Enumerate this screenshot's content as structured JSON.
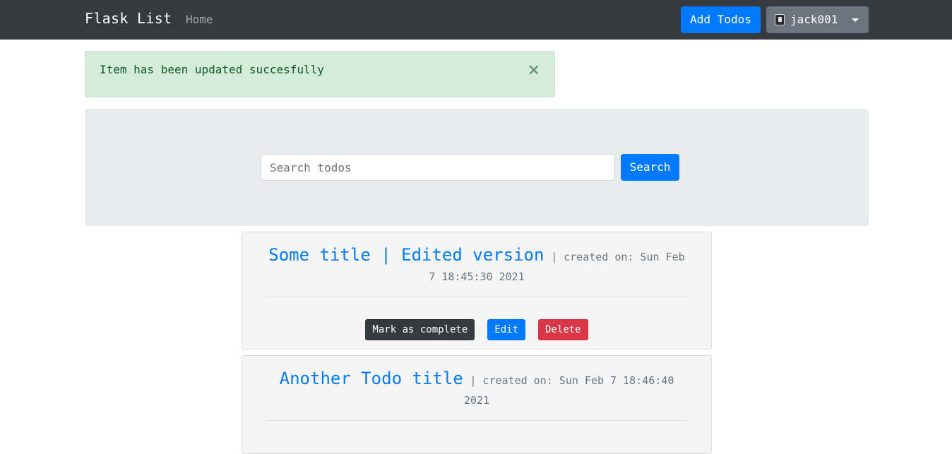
{
  "navbar": {
    "brand": "Flask List",
    "home": "Home",
    "add_todos": "Add Todos",
    "user": "jack001",
    "user_icon": "notebook-icon",
    "dropdown_icon": "caret-down-icon"
  },
  "alert": {
    "message": "Item has been updated succesfully",
    "close": "×"
  },
  "search": {
    "placeholder": "Search todos",
    "value": "",
    "button": "Search"
  },
  "todos": [
    {
      "title": "Some title | Edited version",
      "meta": "| created on: Sun Feb 7 18:45:30 2021",
      "actions": {
        "complete": "Mark as complete",
        "edit": "Edit",
        "delete": "Delete"
      }
    },
    {
      "title": "Another Todo title",
      "meta": "| created on: Sun Feb 7 18:46:40 2021"
    }
  ],
  "colors": {
    "navbar": "#343a40",
    "primary": "#007bff",
    "secondary": "#6c757d",
    "success_bg": "#d4edda",
    "danger": "#dc3545"
  }
}
